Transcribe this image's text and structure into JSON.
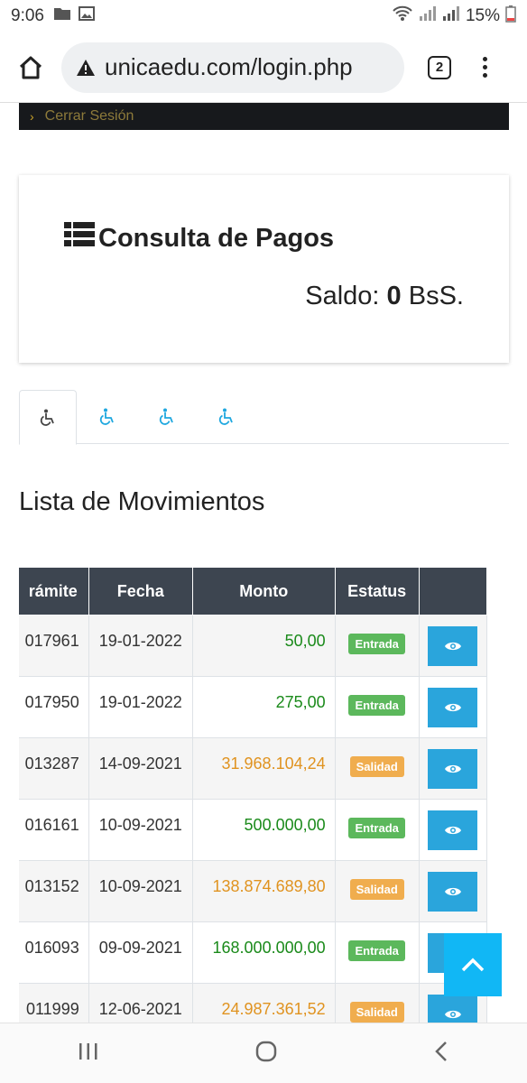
{
  "status_bar": {
    "time": "9:06",
    "battery": "15%"
  },
  "browser": {
    "url": "unicaedu.com/login.php",
    "tab_count": "2"
  },
  "nav_strip": {
    "label": "Cerrar Sesión"
  },
  "card": {
    "title": "Consulta de Pagos",
    "balance_label": "Saldo:",
    "balance_value": "0",
    "balance_unit": "BsS."
  },
  "tabs": [
    {
      "icon": "wheelchair-icon",
      "active": true
    },
    {
      "icon": "wheelchair-icon"
    },
    {
      "icon": "wheelchair-icon"
    },
    {
      "icon": "wheelchair-icon"
    }
  ],
  "section_title": "Lista de Movimientos",
  "table": {
    "headers": {
      "tramite": "rámite",
      "fecha": "Fecha",
      "monto": "Monto",
      "estatus": "Estatus",
      "accion": ""
    },
    "rows": [
      {
        "tramite": "017961",
        "fecha": "19-01-2022",
        "monto": "50,00",
        "estatus": "Entrada"
      },
      {
        "tramite": "017950",
        "fecha": "19-01-2022",
        "monto": "275,00",
        "estatus": "Entrada"
      },
      {
        "tramite": "013287",
        "fecha": "14-09-2021",
        "monto": "31.968.104,24",
        "estatus": "Salidad"
      },
      {
        "tramite": "016161",
        "fecha": "10-09-2021",
        "monto": "500.000,00",
        "estatus": "Entrada"
      },
      {
        "tramite": "013152",
        "fecha": "10-09-2021",
        "monto": "138.874.689,80",
        "estatus": "Salidad"
      },
      {
        "tramite": "016093",
        "fecha": "09-09-2021",
        "monto": "168.000.000,00",
        "estatus": "Entrada"
      },
      {
        "tramite": "011999",
        "fecha": "12-06-2021",
        "monto": "24.987.361,52",
        "estatus": "Salidad"
      }
    ]
  },
  "colors": {
    "entrada": "#5cb85c",
    "salidad": "#f0ad4e",
    "monto_entrada": "#1a8a1a",
    "monto_salidad": "#e09320",
    "header": "#3d4550",
    "view_button": "#2aa5dc",
    "scroll_top": "#11b7f5"
  }
}
